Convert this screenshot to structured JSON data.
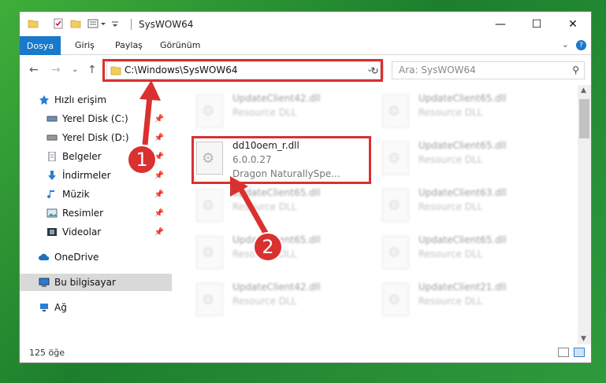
{
  "window": {
    "title": "SysWOW64",
    "controls": {
      "minimize": "—",
      "maximize": "☐",
      "close": "✕"
    }
  },
  "ribbon": {
    "file_tab": "Dosya",
    "tabs": [
      "Giriş",
      "Paylaş",
      "Görünüm"
    ],
    "help": "?"
  },
  "nav": {
    "address": "C:\\Windows\\SysWOW64",
    "search_placeholder": "Ara: SysWOW64"
  },
  "sidebar": {
    "items": [
      {
        "label": "Hızlı erişim",
        "icon": "star-icon"
      },
      {
        "label": "Yerel Disk (C:)",
        "icon": "drive-icon"
      },
      {
        "label": "Yerel Disk (D:)",
        "icon": "drive-icon"
      },
      {
        "label": "Belgeler",
        "icon": "document-icon"
      },
      {
        "label": "İndirmeler",
        "icon": "download-icon"
      },
      {
        "label": "Müzik",
        "icon": "music-icon"
      },
      {
        "label": "Resimler",
        "icon": "picture-icon"
      },
      {
        "label": "Videolar",
        "icon": "video-icon"
      },
      {
        "label": "OneDrive",
        "icon": "cloud-icon"
      },
      {
        "label": "Bu bilgisayar",
        "icon": "computer-icon"
      },
      {
        "label": "Ağ",
        "icon": "network-icon"
      }
    ]
  },
  "files": {
    "highlighted": {
      "name": "dd10oem_r.dll",
      "version": "6.0.0.27",
      "desc": "Dragon NaturallySpe..."
    },
    "blurred": [
      {
        "name": "UpdateClient42.dll",
        "desc": "Resource DLL"
      },
      {
        "name": "UpdateClient65.dll",
        "desc": "Resource DLL"
      },
      {
        "name": "UpdateClient65.dll",
        "desc": "Resource DLL"
      },
      {
        "name": "UpdateClient65.dll",
        "desc": "Resource DLL"
      },
      {
        "name": "UpdateClient63.dll",
        "desc": "Resource DLL"
      },
      {
        "name": "UpdateClient65.dll",
        "desc": "Resource DLL"
      },
      {
        "name": "UpdateClient65.dll",
        "desc": "Resource DLL"
      },
      {
        "name": "UpdateClient42.dll",
        "desc": "Resource DLL"
      },
      {
        "name": "UpdateClient21.dll",
        "desc": "Resource DLL"
      }
    ]
  },
  "status": {
    "count": "125 öğe"
  },
  "callouts": {
    "one": "1",
    "two": "2"
  },
  "colors": {
    "accent": "#1979ca",
    "highlight": "#d9312f"
  }
}
